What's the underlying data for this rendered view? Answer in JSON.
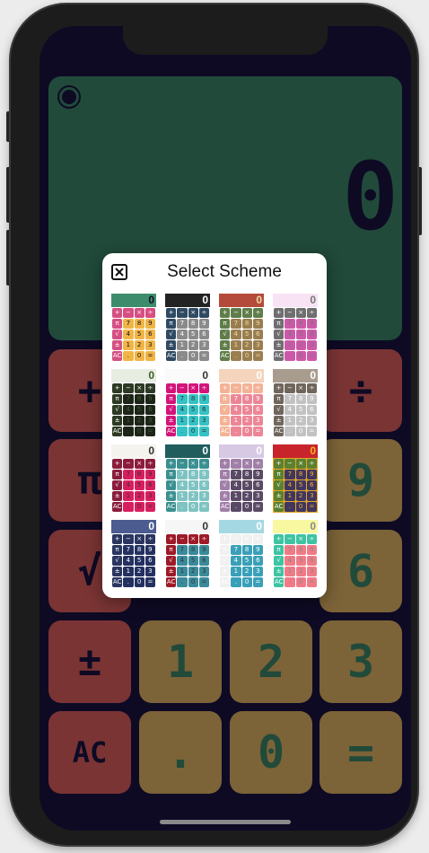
{
  "display": {
    "value": "0"
  },
  "keys": {
    "plus": "+",
    "divide": "÷",
    "pi": "π",
    "sqrt": "√",
    "plusminus": "±",
    "ac": "AC",
    "nine": "9",
    "six": "6",
    "one": "1",
    "two": "2",
    "three": "3",
    "dot": ".",
    "zero": "0",
    "equals": "="
  },
  "modal": {
    "title": "Select Scheme",
    "close_icon": "close-icon",
    "thumbnail_value": "0",
    "schemes": [
      {
        "disp": "#3d8d6c",
        "txt": "#0e0a24",
        "op": "#d64f82",
        "num": "#f0b545",
        "bg": "#fff"
      },
      {
        "disp": "#232323",
        "txt": "#ffffff",
        "op": "#2f4a62",
        "num": "#8a8a8a",
        "bg": "#fff"
      },
      {
        "disp": "#b44a3a",
        "txt": "#e9d9a8",
        "op": "#5f7d4a",
        "num": "#9a7e50",
        "bg": "#fff"
      },
      {
        "disp": "#f8e3f4",
        "txt": "#777777",
        "op": "#6f6f6f",
        "num": "#cc58a8",
        "bg": "#fff"
      },
      {
        "disp": "#e8ede2",
        "txt": "#3e5c2c",
        "op": "#2d3a24",
        "num": "#1d2418",
        "bg": "#fff"
      },
      {
        "disp": "#fafafa",
        "txt": "#333333",
        "op": "#d4147a",
        "num": "#35c2c4",
        "bg": "#fff"
      },
      {
        "disp": "#f4d4bc",
        "txt": "#ffffff",
        "op": "#f4b296",
        "num": "#ec8696",
        "bg": "#fff"
      },
      {
        "disp": "#a89c8f",
        "txt": "#ffffff",
        "op": "#6f665c",
        "num": "#c2c2c2",
        "bg": "#fff"
      },
      {
        "disp": "#f5f3ee",
        "txt": "#333333",
        "op": "#8a1d3c",
        "num": "#d81e5f",
        "bg": "#fff"
      },
      {
        "disp": "#215d5d",
        "txt": "#ffffff",
        "op": "#3b8f90",
        "num": "#7fc3c2",
        "bg": "#fff"
      },
      {
        "disp": "#d7c8e4",
        "txt": "#ffffff",
        "op": "#a07fa8",
        "num": "#5a4a65",
        "bg": "#fff"
      },
      {
        "disp": "#c8242c",
        "txt": "#f3b320",
        "op": "#5b8030",
        "num": "#403660",
        "bg": "#e2a628"
      },
      {
        "disp": "#4c5c90",
        "txt": "#ffffff",
        "op": "#2a3560",
        "num": "#233060",
        "bg": "#fff"
      },
      {
        "disp": "#f6f6f6",
        "txt": "#333333",
        "op": "#9e1a28",
        "num": "#3a8a9a",
        "bg": "#fff"
      },
      {
        "disp": "#a4d8e2",
        "txt": "#ffffff",
        "op": "#f0f0f0",
        "num": "#3aa0b8",
        "bg": "#fff"
      },
      {
        "disp": "#f8f8a0",
        "txt": "#888888",
        "op": "#3ec4a2",
        "num": "#f07a86",
        "bg": "#fff"
      }
    ]
  }
}
